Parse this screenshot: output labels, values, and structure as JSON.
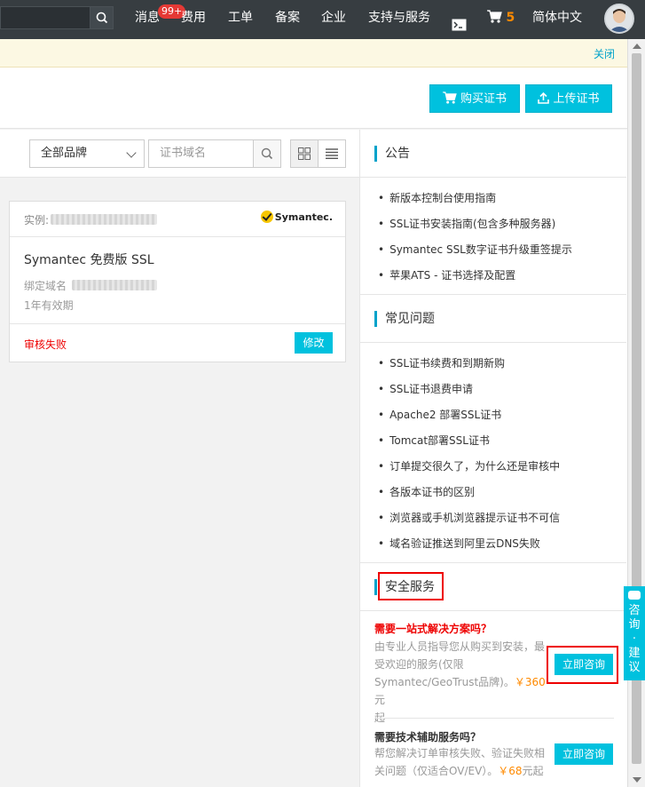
{
  "nav": {
    "items": [
      {
        "label": "消息"
      },
      {
        "label": "费用"
      },
      {
        "label": "工单"
      },
      {
        "label": "备案"
      },
      {
        "label": "企业"
      },
      {
        "label": "支持与服务"
      },
      {
        "label": "简体中文"
      }
    ],
    "message_badge": "99+",
    "cart_count": "5",
    "icons": [
      "search-icon",
      "terminal-icon",
      "cart-icon",
      "avatar"
    ]
  },
  "notice": {
    "close_label": "关闭"
  },
  "toolbar": {
    "buy_label": "购买证书",
    "upload_label": "上传证书"
  },
  "filter": {
    "brand_select": "全部品牌",
    "domain_placeholder": "证书域名"
  },
  "card": {
    "instance_label": "实例:",
    "brand_logo": "Symantec.",
    "product_name": "Symantec 免费版 SSL",
    "bound_domain_label": "绑定域名",
    "validity": "1年有效期",
    "status": "审核失败",
    "edit_label": "修改"
  },
  "sidebar": {
    "announcements": {
      "title": "公告",
      "items": [
        "新版本控制台使用指南",
        "SSL证书安装指南(包含多种服务器)",
        "Symantec SSL数字证书升级重签提示",
        "苹果ATS - 证书选择及配置"
      ]
    },
    "faq": {
      "title": "常见问题",
      "items": [
        "SSL证书续费和到期新购",
        "SSL证书退费申请",
        "Apache2 部署SSL证书",
        "Tomcat部署SSL证书",
        "订单提交很久了，为什么还是审核中",
        "各版本证书的区别",
        "浏览器或手机浏览器提示证书不可信",
        "域名验证推送到阿里云DNS失败"
      ]
    },
    "security": {
      "title": "安全服务",
      "service1": {
        "title": "需要一站式解决方案吗？",
        "desc_line1": "由专业人员指导您从购买到安装，最",
        "desc_line2": "受欢迎的服务(仅限",
        "desc_line3a": "Symantec/GeoTrust品牌)。",
        "price": "￥360",
        "desc_line3b": "元",
        "desc_line4": "起",
        "button": "立即咨询"
      },
      "service2": {
        "title": "需要技术辅助服务吗？",
        "desc_line1": "帮您解决订单审核失败、验证失败相",
        "desc_line2a": "关问题（仅适合OV/EV）。",
        "price": "￥68",
        "desc_line2b": "元起",
        "button": "立即咨询"
      }
    }
  },
  "float_widget": {
    "label_line1": "咨",
    "label_line2": "询",
    "dot": "·",
    "label_line3": "建",
    "label_line4": "议"
  },
  "colors": {
    "accent": "#00c1de",
    "nav_bg": "#373d41",
    "danger": "#e00",
    "price": "#ff8a00"
  }
}
